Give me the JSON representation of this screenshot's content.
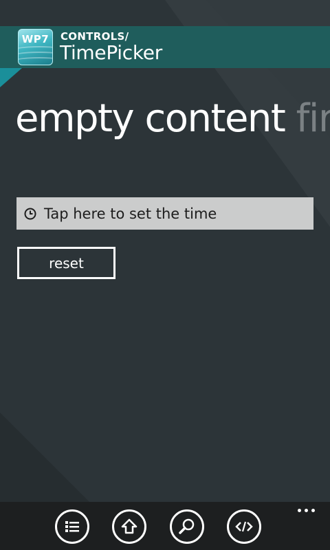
{
  "header": {
    "logo_text": "WP7",
    "kicker": "CONTROLS/",
    "title": "TimePicker"
  },
  "pivot": {
    "active_label": "empty content",
    "next_label": "firs"
  },
  "time_picker": {
    "placeholder_text": "Tap here to set the time",
    "icon": "clock-icon"
  },
  "reset_button": {
    "label": "reset"
  },
  "app_bar": {
    "buttons": [
      {
        "icon": "list-icon"
      },
      {
        "icon": "home-icon"
      },
      {
        "icon": "search-icon"
      },
      {
        "icon": "code-icon"
      }
    ],
    "more_icon": "ellipsis-icon"
  },
  "colors": {
    "background": "#2c3438",
    "header_band": "#1f5d5c",
    "accent": "#1a8f9a",
    "field_bg": "#cbcccc",
    "app_bar": "#1d1f20"
  }
}
